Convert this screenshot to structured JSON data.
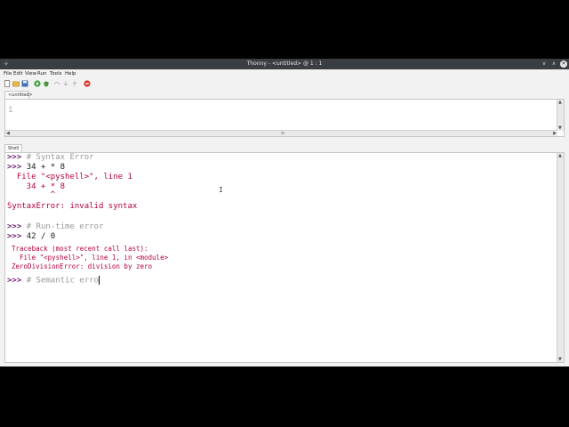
{
  "window": {
    "title": "Thonny - <untitled> @ 1 : 1"
  },
  "menu": [
    "File",
    "Edit",
    "View",
    "Run",
    "Tools",
    "Help"
  ],
  "editor": {
    "tab_label": "<untitled>",
    "line_number": "1"
  },
  "shell": {
    "tab_label": "Shell",
    "prompt": ">>>",
    "lines": [
      {
        "kind": "input",
        "prompt": ">>>",
        "text": "# Syntax Error",
        "style": "comment"
      },
      {
        "kind": "input",
        "prompt": ">>>",
        "text": "34 + * 8",
        "style": "code"
      },
      {
        "kind": "error",
        "text": "  File \"<pyshell>\", line 1"
      },
      {
        "kind": "error",
        "text": "    34 + * 8"
      },
      {
        "kind": "error",
        "text": "         ^"
      },
      {
        "kind": "error",
        "text": "SyntaxError: invalid syntax"
      },
      {
        "kind": "blank",
        "text": ""
      },
      {
        "kind": "input",
        "prompt": ">>>",
        "text": "# Run-time error",
        "style": "comment"
      },
      {
        "kind": "input",
        "prompt": ">>>",
        "text": "42 / 0",
        "style": "code"
      },
      {
        "kind": "error_small",
        "text": "Traceback (most recent call last):"
      },
      {
        "kind": "error_small",
        "text": "  File \"<pyshell>\", line 1, in <module>"
      },
      {
        "kind": "error_small",
        "text": "ZeroDivisionError: division by zero"
      },
      {
        "kind": "input_active",
        "prompt": ">>>",
        "text": "# Semantic erro",
        "style": "comment"
      }
    ]
  },
  "icons": {
    "app": "thonny-app-icon",
    "toolbar": [
      "new-file-icon",
      "open-file-icon",
      "save-icon",
      "run-icon",
      "debug-icon",
      "step-over-icon",
      "step-into-icon",
      "step-out-icon",
      "stop-icon"
    ]
  }
}
